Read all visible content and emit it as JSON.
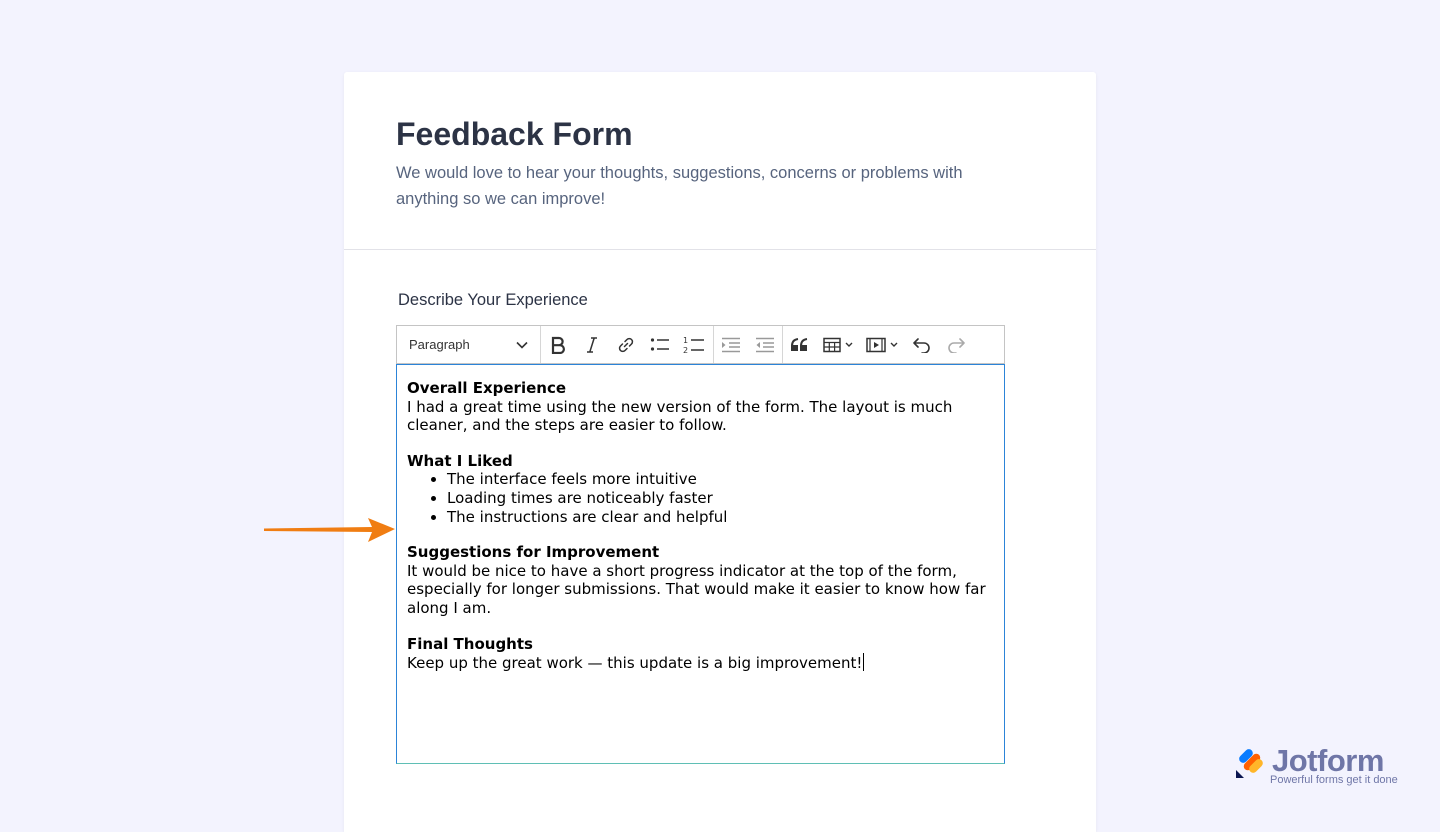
{
  "form": {
    "title": "Feedback Form",
    "subtitle": "We would love to hear your thoughts, suggestions, concerns or problems with anything so we can improve!"
  },
  "field": {
    "label": "Describe Your Experience"
  },
  "toolbar": {
    "paragraph_select": "Paragraph",
    "buttons": [
      "bold-icon",
      "italic-icon",
      "link-icon",
      "bulleted-list-icon",
      "numbered-list-icon",
      "indent-icon",
      "outdent-icon",
      "blockquote-icon",
      "table-icon",
      "media-icon",
      "undo-icon",
      "redo-icon"
    ]
  },
  "editor": {
    "sections": [
      {
        "heading": "Overall Experience",
        "body": "I had a great time using the new version of the form. The layout is much cleaner, and the steps are easier to follow."
      },
      {
        "heading": "What I Liked",
        "items": [
          "The interface feels more intuitive",
          "Loading times are noticeably faster",
          "The instructions are clear and helpful"
        ]
      },
      {
        "heading": "Suggestions for Improvement",
        "body": "It would be nice to have a short progress indicator at the top of the form, especially for longer submissions. That would make it easier to know how far along I am."
      },
      {
        "heading": "Final Thoughts",
        "body": "Keep up the great work — this update is a big improvement!"
      }
    ]
  },
  "brand": {
    "name": "Jotform",
    "tagline": "Powerful forms get it done"
  },
  "colors": {
    "background": "#f3f3fe",
    "title": "#2c3345",
    "subtitle": "#57647e",
    "focus_border": "#2c84d8",
    "arrow": "#f07d12",
    "brand": "#6f76a7"
  }
}
